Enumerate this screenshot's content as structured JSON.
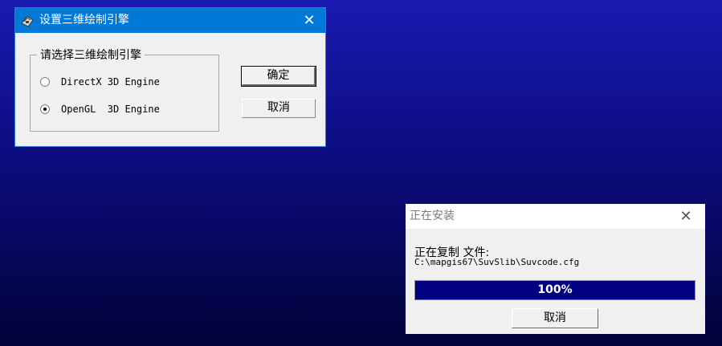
{
  "engine_dialog": {
    "title": "设置三维绘制引擎",
    "close_glyph": "✕",
    "group_label": "请选择三维绘制引擎",
    "options": [
      {
        "label": "DirectX 3D Engine",
        "selected": false
      },
      {
        "label": "OpenGL  3D Engine",
        "selected": true
      }
    ],
    "ok_label": "确定",
    "cancel_label": "取消"
  },
  "install_dialog": {
    "title": "正在安装",
    "close_glyph": "✕",
    "copy_label": "正在复制 文件:",
    "file_path": "C:\\mapgis67\\SuvSlib\\Suvcode.cfg",
    "progress_text": "100%",
    "progress_value": 1.0,
    "cancel_label": "取消"
  },
  "colors": {
    "desktop_top": "#1a1ab0",
    "desktop_bottom": "#020238",
    "title_bar": "#0078d7",
    "progress_fill": "#000080"
  }
}
